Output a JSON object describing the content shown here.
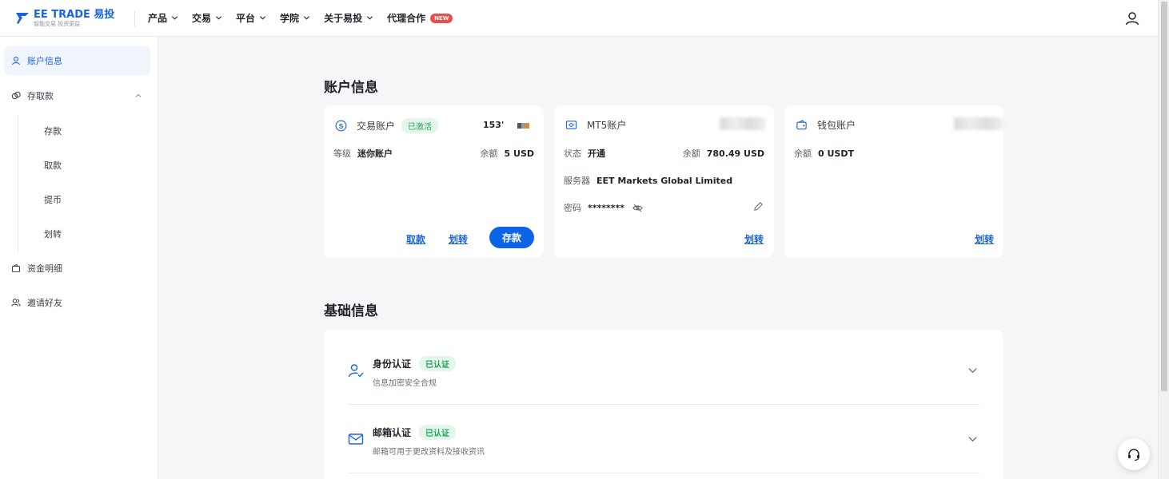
{
  "brand": {
    "name": "EE TRADE 易投",
    "slogan": "智能交易 投资更益",
    "color": "#1a63e0"
  },
  "nav": [
    {
      "label": "产品",
      "dropdown": true
    },
    {
      "label": "交易",
      "dropdown": true
    },
    {
      "label": "平台",
      "dropdown": true
    },
    {
      "label": "学院",
      "dropdown": true
    },
    {
      "label": "关于易投",
      "dropdown": true
    },
    {
      "label": "代理合作",
      "badge": "NEW"
    }
  ],
  "sidebar": {
    "items": [
      {
        "label": "账户信息",
        "icon": "user-icon",
        "active": true
      },
      {
        "label": "存取款",
        "icon": "deposit-icon",
        "expanded": true
      },
      {
        "label": "资金明细",
        "icon": "wallet-icon"
      },
      {
        "label": "邀请好友",
        "icon": "friends-icon"
      }
    ],
    "subitems": [
      "存款",
      "取款",
      "提币",
      "划转"
    ]
  },
  "account_section": {
    "title": "账户信息",
    "trading": {
      "title": "交易账户",
      "status": "已激活",
      "account_no": "153'",
      "level_label": "等级",
      "level_value": "迷你账户",
      "balance_label": "余额",
      "balance_value": "5 USD",
      "withdraw": "取款",
      "transfer": "划转",
      "deposit": "存款"
    },
    "mt5": {
      "title": "MT5账户",
      "status_label": "状态",
      "status_value": "开通",
      "balance_label": "余额",
      "balance_value": "780.49 USD",
      "server_label": "服务器",
      "server_value": "EET Markets Global Limited",
      "password_label": "密码",
      "password_value": "********",
      "transfer": "划转"
    },
    "wallet": {
      "title": "钱包账户",
      "balance_label": "余额",
      "balance_value": "0 USDT",
      "transfer": "划转"
    }
  },
  "basic_section": {
    "title": "基础信息",
    "items": [
      {
        "title": "身份认证",
        "status": "已认证",
        "desc": "信息加密安全合规"
      },
      {
        "title": "邮箱认证",
        "status": "已认证",
        "desc": "邮箱可用于更改资料及接收资讯"
      }
    ]
  },
  "colors": {
    "accent": "#0b63e5",
    "verified_bg": "#e4f6ec",
    "verified_text": "#23a55a",
    "new_badge": "#f04a4a"
  }
}
